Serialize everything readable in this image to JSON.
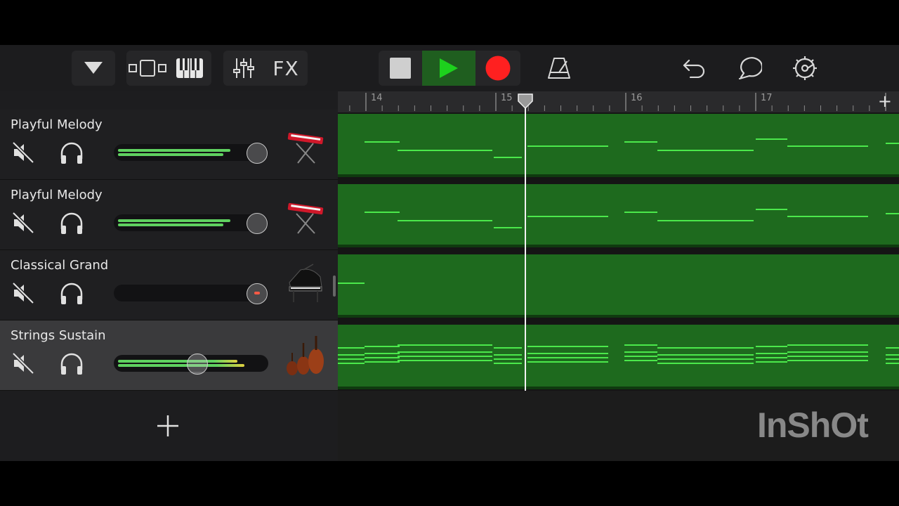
{
  "toolbar": {
    "fx_label": "FX"
  },
  "ruler": {
    "bars": [
      "14",
      "15",
      "16",
      "17"
    ],
    "add_label": "+"
  },
  "tracks": [
    {
      "name": "Playful Melody",
      "volume": 0.74,
      "instrument": "synth-keyboard-icon",
      "selected": false
    },
    {
      "name": "Playful Melody",
      "volume": 0.74,
      "instrument": "synth-keyboard-icon",
      "selected": false
    },
    {
      "name": "Classical Grand",
      "volume": 0.0,
      "instrument": "grand-piano-icon",
      "selected": false
    },
    {
      "name": "Strings Sustain",
      "volume": 0.55,
      "instrument": "strings-icon",
      "selected": true
    }
  ],
  "add_track_label": "+",
  "watermark": "InShOt",
  "colors": {
    "region_green": "#1e6a1e",
    "note_green": "#4be84b",
    "play_green": "#1dd11d",
    "record_red": "#ff2020",
    "meter_green": "#5fd160"
  }
}
